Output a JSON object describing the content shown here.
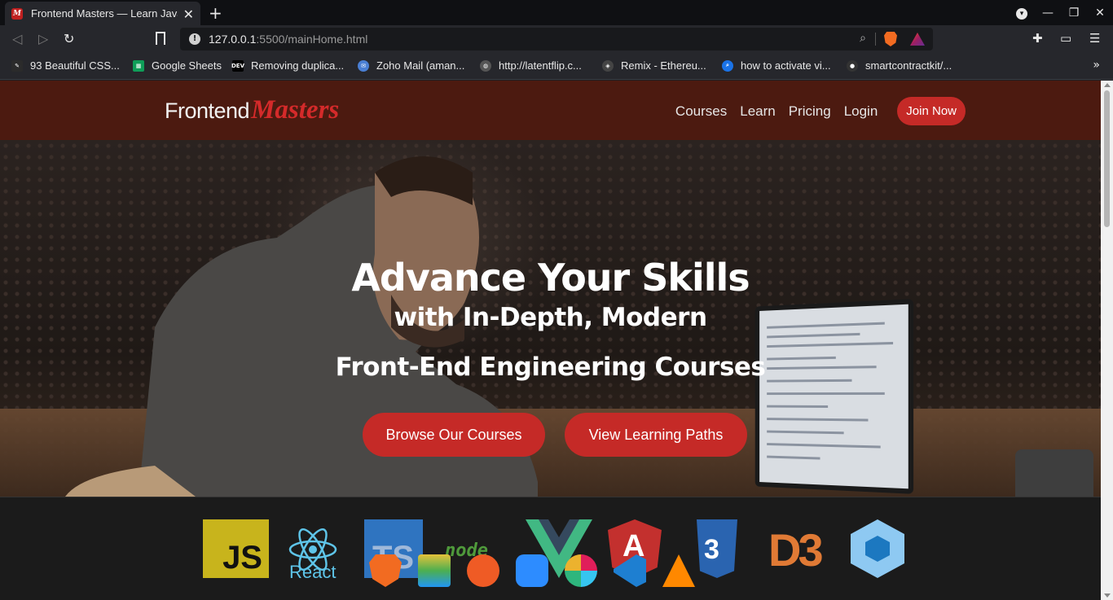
{
  "browser": {
    "tab": {
      "title": "Frontend Masters — Learn Java",
      "favicon": "M"
    },
    "url": {
      "host": "127.0.0.1",
      "path": ":5500/mainHome.html"
    },
    "bookmarks": [
      {
        "label": "93 Beautiful CSS...",
        "icon": "brush-icon",
        "color": "#2b2b2b"
      },
      {
        "label": "Google Sheets",
        "icon": "sheets-icon",
        "color": "#0f9d58"
      },
      {
        "label": "Removing duplica...",
        "icon": "dev-icon",
        "color": "#000000"
      },
      {
        "label": "Zoho Mail (aman...",
        "icon": "mail-icon",
        "color": "#4a7fd4"
      },
      {
        "label": "http://latentflip.c...",
        "icon": "globe-icon",
        "color": "#555555"
      },
      {
        "label": "Remix - Ethereu...",
        "icon": "remix-icon",
        "color": "#444444"
      },
      {
        "label": "how to activate vi...",
        "icon": "search-icon",
        "color": "#1a73e8"
      },
      {
        "label": "smartcontractkit/...",
        "icon": "github-icon",
        "color": "#333333"
      }
    ]
  },
  "site": {
    "logo": {
      "part1": "Frontend",
      "part2": "Masters"
    },
    "nav": [
      "Courses",
      "Learn",
      "Pricing",
      "Login"
    ],
    "join_label": "Join Now",
    "hero": {
      "title": "Advance Your Skills",
      "line2": "with In-Depth, Modern",
      "line3": "Front-End Engineering Courses",
      "btn_courses": "Browse Our Courses",
      "btn_paths": "View Learning Paths"
    },
    "tech": {
      "js": "JS",
      "react": "React",
      "ts": "TS",
      "node": "node",
      "angular": "A",
      "css": "3",
      "d3": "D3"
    }
  },
  "colors": {
    "brand_red": "#c52a27",
    "header_bg": "#4c1a10"
  }
}
